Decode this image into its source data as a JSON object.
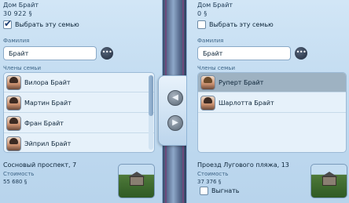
{
  "left": {
    "household_name": "Дом Брайт",
    "funds": "30 922 §",
    "select_label": "Выбрать эту семью",
    "select_checked": true,
    "surname_label": "Фамилия",
    "surname_value": "Брайт",
    "more_button": "•••",
    "members_label": "Члены семьи",
    "members": [
      {
        "name": "Вилора Брайт"
      },
      {
        "name": "Мартин Брайт"
      },
      {
        "name": "Фран Брайт"
      },
      {
        "name": "Эйприл Брайт"
      }
    ],
    "address": "Сосновый проспект, 7",
    "value_label": "Стоимость",
    "value": "55 680 §"
  },
  "right": {
    "household_name": "Дом Брайт",
    "funds": "0 §",
    "select_label": "Выбрать эту семью",
    "select_checked": false,
    "surname_label": "Фамилия",
    "surname_value": "Брайт",
    "more_button": "•••",
    "members_label": "Члены семьи",
    "members": [
      {
        "name": "Руперт Брайт",
        "selected": true
      },
      {
        "name": "Шарлотта Брайт"
      }
    ],
    "address": "Проезд Лугового пляжа, 13",
    "value_label": "Стоимость",
    "value": "37 376 §",
    "evict_label": "Выгнать"
  },
  "transfer": {
    "to_left_icon": "arrow-left-icon",
    "to_right_icon": "arrow-right-icon"
  },
  "colors": {
    "panel_bg": "#c3dcf1",
    "divider": "#5b6f92",
    "selected_row": "#9eb2c2"
  }
}
